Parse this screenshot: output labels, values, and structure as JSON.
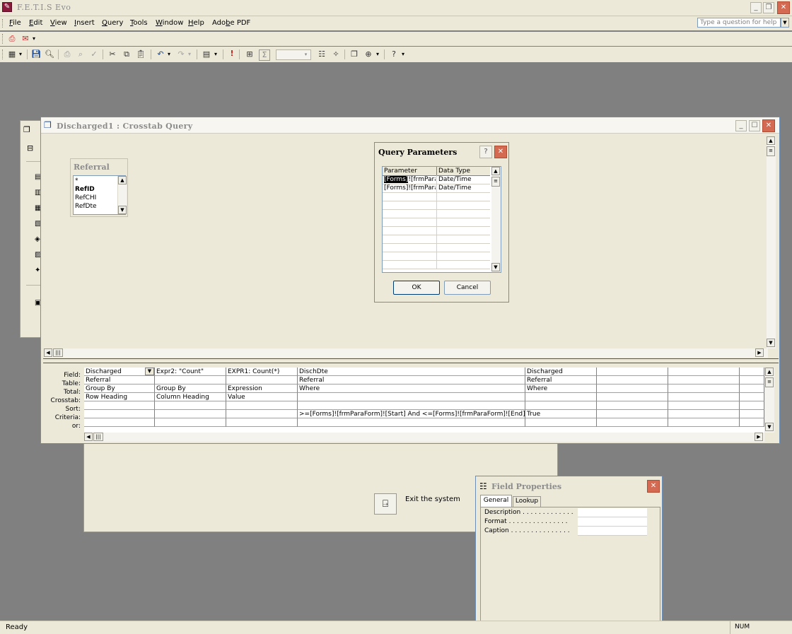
{
  "app": {
    "title": "F.E.T.I.S Evo"
  },
  "menu": {
    "items": [
      {
        "key": "F",
        "rest": "ile"
      },
      {
        "key": "E",
        "rest": "dit"
      },
      {
        "key": "V",
        "rest": "iew"
      },
      {
        "key": "I",
        "rest": "nsert"
      },
      {
        "key": "Q",
        "rest": "uery"
      },
      {
        "key": "T",
        "rest": "ools"
      },
      {
        "key": "W",
        "rest": "indow"
      },
      {
        "key": "H",
        "rest": "elp"
      }
    ],
    "adobe": {
      "pre": "Ado",
      "key": "b",
      "rest": "e PDF"
    },
    "help_placeholder": "Type a question for help"
  },
  "query_window": {
    "title": "Discharged1 : Crosstab Query",
    "table": {
      "name": "Referral",
      "fields": [
        "*",
        "RefID",
        "RefCHI",
        "RefDte"
      ]
    }
  },
  "grid": {
    "row_labels": [
      "Field:",
      "Table:",
      "Total:",
      "Crosstab:",
      "Sort:",
      "Criteria:",
      "or:"
    ],
    "columns": [
      {
        "field": "Discharged",
        "table": "Referral",
        "total": "Group By",
        "crosstab": "Row Heading",
        "sort": "",
        "criteria": "",
        "or": ""
      },
      {
        "field": "Expr2: \"Count\"",
        "table": "",
        "total": "Group By",
        "crosstab": "Column Heading",
        "sort": "",
        "criteria": "",
        "or": ""
      },
      {
        "field": "EXPR1: Count(*)",
        "table": "",
        "total": "Expression",
        "crosstab": "Value",
        "sort": "",
        "criteria": "",
        "or": ""
      },
      {
        "field": "DischDte",
        "table": "Referral",
        "total": "Where",
        "crosstab": "",
        "sort": "",
        "criteria": ">=[Forms]![frmParaForm]![Start] And <=[Forms]![frmParaForm]![End]",
        "or": ""
      },
      {
        "field": "Discharged",
        "table": "Referral",
        "total": "Where",
        "crosstab": "",
        "sort": "",
        "criteria": "True",
        "or": ""
      }
    ]
  },
  "dialog": {
    "title": "Query Parameters",
    "col_parameter": "Parameter",
    "col_type": "Data Type",
    "rows": [
      {
        "param_a": "[Forms]",
        "param_b": "![frmPara",
        "type": "Date/Time"
      },
      {
        "param_a": "[Forms]",
        "param_b": "![frmPara",
        "type": "Date/Time"
      }
    ],
    "ok": "OK",
    "cancel": "Cancel"
  },
  "background_form": {
    "exit_label": "Exit the system"
  },
  "field_properties": {
    "title": "Field Properties",
    "tabs": [
      "General",
      "Lookup"
    ],
    "rows": [
      {
        "label": "Description . . . . . . . . . . . . .",
        "value": ""
      },
      {
        "label": "Format . . . . . . . . . . . . . . .",
        "value": ""
      },
      {
        "label": "Caption . . . . . . . . . . . . . . .",
        "value": ""
      }
    ]
  },
  "status": {
    "left": "Ready",
    "num": "NUM"
  }
}
